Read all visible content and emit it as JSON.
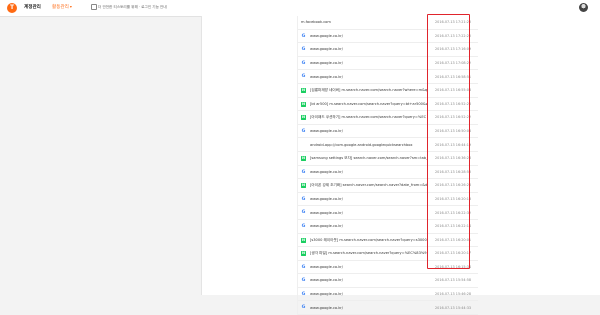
{
  "header": {
    "logo_glyph": "T",
    "app_title": "계정관리",
    "menu_label": "활동관리",
    "menu_chevron": "▾",
    "notice": "더 안전한 티스토리를 위해 · 로그인 기능 안내"
  },
  "colors": {
    "accent": "#ff6a13",
    "highlight": "#e0242c",
    "naver": "#19ce60",
    "google": "#4285f4"
  },
  "history": [
    {
      "icon": "none",
      "url": "m.facebook.com",
      "time": "2016-07-13 17:21:20"
    },
    {
      "icon": "google-icon",
      "url": "www.google.co.kr/",
      "time": "2016-07-13 17:22:20"
    },
    {
      "icon": "google-icon",
      "url": "www.google.co.kr/",
      "time": "2016-07-13 17:16:09"
    },
    {
      "icon": "google-icon",
      "url": "www.google.co.kr/",
      "time": "2016-07-13 17:08:22"
    },
    {
      "icon": "google-icon",
      "url": "www.google.co.kr/",
      "time": "2016-07-13 16:58:51"
    },
    {
      "icon": "naver-icon",
      "url": "[검룡파재방 네이버] m.search.naver.com/search.naver?where=m&query=",
      "time": "2016-07-13 16:55:08"
    },
    {
      "icon": "naver-icon",
      "url": "[bt ar500] m.search.naver.com/search.naver?query=bt+ar500&where=",
      "time": "2016-07-13 16:52:28"
    },
    {
      "icon": "naver-icon",
      "url": "[아이패드 쿠션하기] m.search.naver.com/search.naver?query=%EC",
      "time": "2016-07-13 16:52:22"
    },
    {
      "icon": "google-icon",
      "url": "www.google.co.kr/",
      "time": "2016-07-13 16:50:06"
    },
    {
      "icon": "none",
      "url": "android-app://com.google.android.googlequicksearchbox",
      "time": "2016-07-13 16:44:19"
    },
    {
      "icon": "naver-icon",
      "url": "[samsung settings 모자] search.naver.com/search.naver?sm=tab_hty",
      "time": "2016-07-13 16:36:28"
    },
    {
      "icon": "google-icon",
      "url": "www.google.co.kr/",
      "time": "2016-07-13 16:28:50"
    },
    {
      "icon": "naver-icon",
      "url": "[아이폰 강제 초기화] search.naver.com/search.naver?date_from=&date",
      "time": "2016-07-13 16:26:26"
    },
    {
      "icon": "google-icon",
      "url": "www.google.co.kr/",
      "time": "2016-07-13 16:20:13"
    },
    {
      "icon": "google-icon",
      "url": "www.google.co.kr/",
      "time": "2016-07-13 16:22:32"
    },
    {
      "icon": "google-icon",
      "url": "www.google.co.kr/",
      "time": "2016-07-13 16:22:14"
    },
    {
      "icon": "naver-icon",
      "url": "[s3000 레이아웃] m.search.naver.com/search.naver?query=s3000+",
      "time": "2016-07-13 16:20:01"
    },
    {
      "icon": "naver-icon",
      "url": "[생각 파일] m.search.naver.com/search.naver?query=%EC%83%9D",
      "time": "2016-07-13 16:20:17"
    },
    {
      "icon": "google-icon",
      "url": "www.google.co.kr/",
      "time": "2016-07-13 16:15:34"
    },
    {
      "icon": "google-icon",
      "url": "www.google.co.kr/",
      "time": "2016-07-13 15:54:58"
    },
    {
      "icon": "google-icon",
      "url": "www.google.co.kr/",
      "time": "2016-07-13 15:46:28"
    },
    {
      "icon": "google-icon",
      "url": "www.google.co.kr/",
      "time": "2016-07-13 15:44:33"
    }
  ]
}
